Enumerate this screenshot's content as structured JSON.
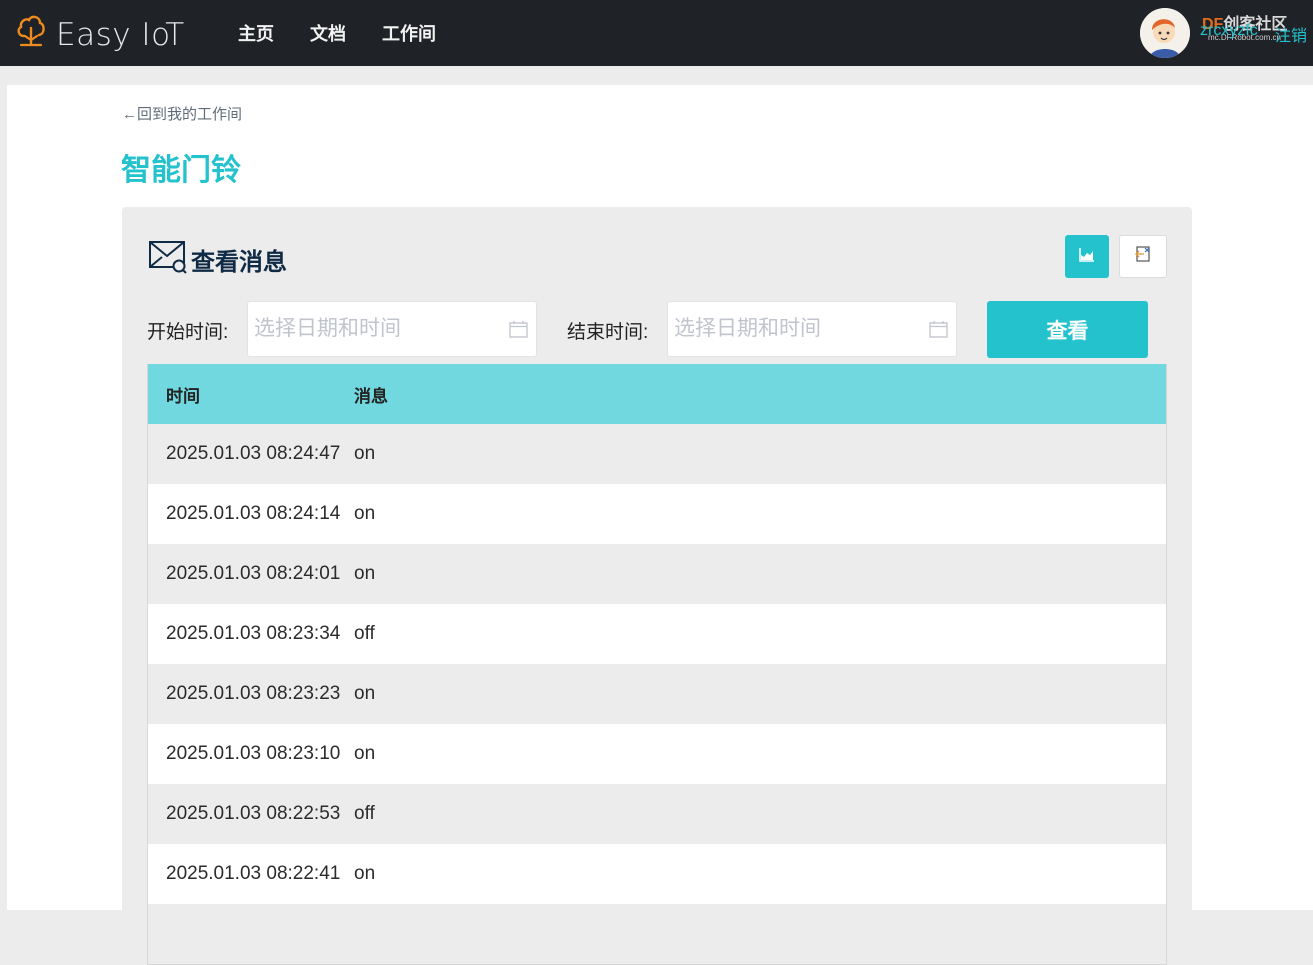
{
  "header": {
    "app_name": "Easy IoT",
    "nav": [
      "主页",
      "文档",
      "工作间"
    ],
    "brand_prefix": "DF",
    "brand_suffix": "创客社区",
    "brand_sub": "mc.DFRobot.com.cn",
    "username": "zrcxyzfc",
    "logout_label": "注销"
  },
  "page": {
    "back_link": "←回到我的工作间",
    "device_title": "智能门铃"
  },
  "messages_panel": {
    "title": "查看消息",
    "icons": {
      "title_icon": "mail-search-icon",
      "chart_button_icon": "chart-icon",
      "export_button_icon": "export-icon"
    },
    "start_label": "开始时间:",
    "end_label": "结束时间:",
    "start_placeholder": "选择日期和时间",
    "end_placeholder": "选择日期和时间",
    "start_value": "",
    "end_value": "",
    "query_button": "查看",
    "table": {
      "columns": [
        "时间",
        "消息"
      ],
      "rows": [
        {
          "time": "2025.01.03 08:24:47",
          "message": "on"
        },
        {
          "time": "2025.01.03 08:24:14",
          "message": "on"
        },
        {
          "time": "2025.01.03 08:24:01",
          "message": "on"
        },
        {
          "time": "2025.01.03 08:23:34",
          "message": "off"
        },
        {
          "time": "2025.01.03 08:23:23",
          "message": "on"
        },
        {
          "time": "2025.01.03 08:23:10",
          "message": "on"
        },
        {
          "time": "2025.01.03 08:22:53",
          "message": "off"
        },
        {
          "time": "2025.01.03 08:22:41",
          "message": "on"
        }
      ]
    }
  },
  "colors": {
    "accent": "#23c2cc",
    "header_bg": "#1f2328",
    "table_header_bg": "#70d8de",
    "title_dark": "#0f2a44",
    "logo_orange": "#f08c1e"
  }
}
